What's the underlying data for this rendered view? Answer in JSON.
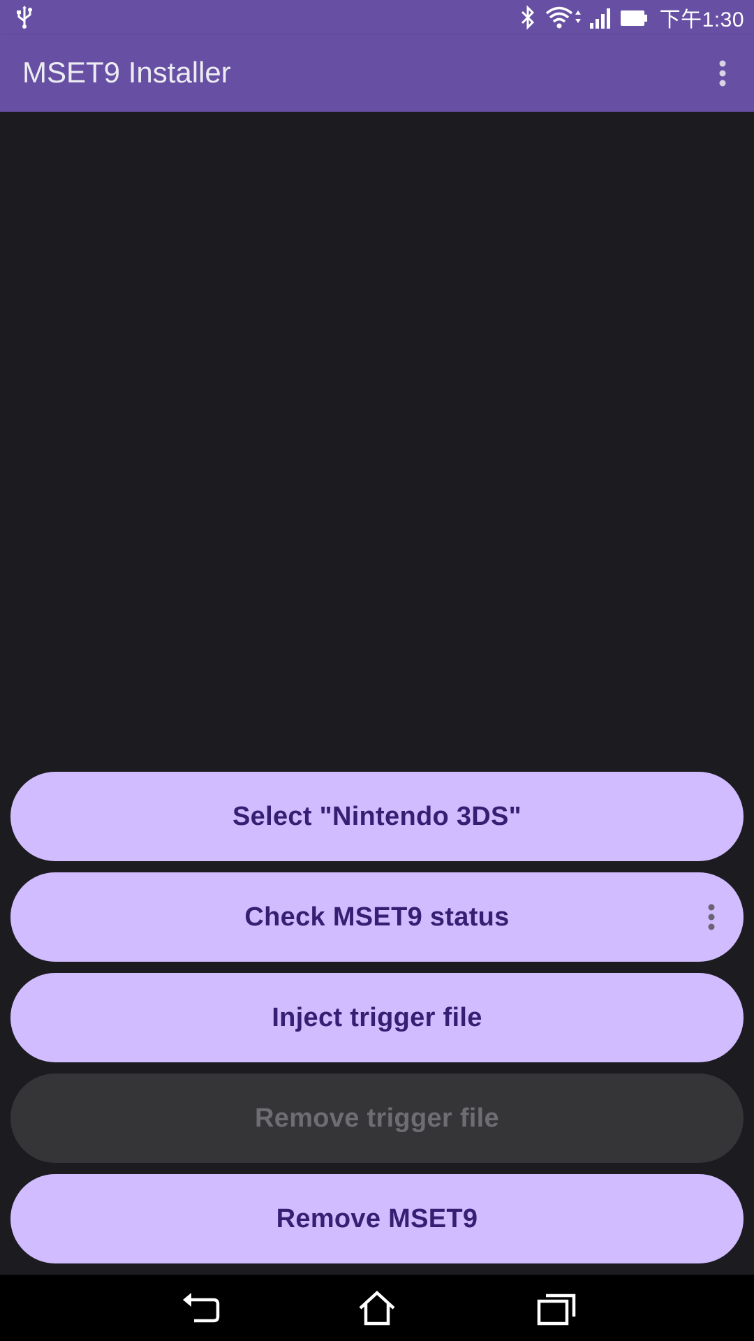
{
  "status_bar": {
    "time": "下午1:30",
    "icons": [
      "usb-icon",
      "bluetooth-icon",
      "wifi-icon",
      "signal-icon",
      "battery-icon"
    ]
  },
  "app_bar": {
    "title": "MSET9 Installer",
    "menu_icon": "more-vert-icon"
  },
  "buttons": [
    {
      "label": "Select \"Nintendo 3DS\"",
      "enabled": true
    },
    {
      "label": "Check MSET9 status",
      "enabled": true
    },
    {
      "label": "Inject trigger file",
      "enabled": true
    },
    {
      "label": "Remove trigger file",
      "enabled": false
    },
    {
      "label": "Remove MSET9",
      "enabled": true
    }
  ],
  "nav_bar": {
    "icons": [
      "back-icon",
      "home-icon",
      "recents-icon"
    ]
  },
  "colors": {
    "primary": "#6750a4",
    "button_bg": "#d0bcff",
    "button_text": "#381e72",
    "disabled_bg": "#353437",
    "disabled_text": "#6e6d72",
    "background": "#1c1b1f"
  }
}
